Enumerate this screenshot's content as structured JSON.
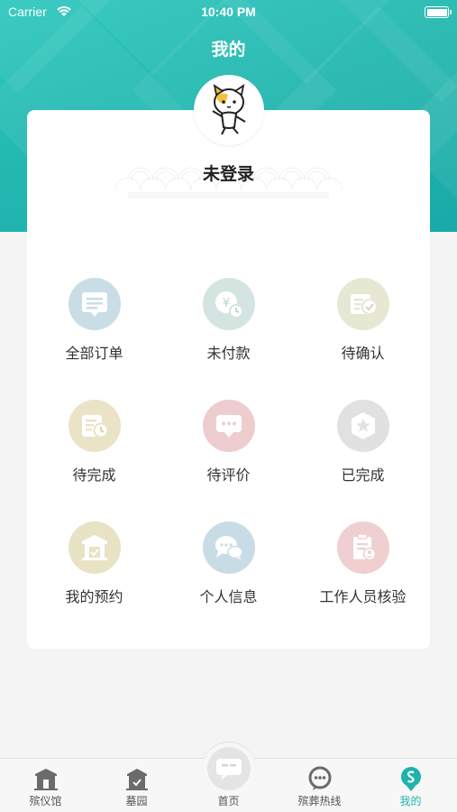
{
  "status_bar": {
    "carrier": "Carrier",
    "time": "10:40 PM"
  },
  "header": {
    "title": "我的"
  },
  "profile": {
    "login_status": "未登录",
    "avatar_icon": "cat-mascot-icon"
  },
  "menu": {
    "items": [
      {
        "label": "全部订单",
        "icon": "order-list-icon",
        "color": "#c9dde6"
      },
      {
        "label": "未付款",
        "icon": "unpaid-yen-clock-icon",
        "color": "#d4e5e1"
      },
      {
        "label": "待确认",
        "icon": "pending-confirm-icon",
        "color": "#e6e8d3"
      },
      {
        "label": "待完成",
        "icon": "pending-complete-icon",
        "color": "#ebe3c7"
      },
      {
        "label": "待评价",
        "icon": "pending-review-chat-icon",
        "color": "#eecdcf"
      },
      {
        "label": "已完成",
        "icon": "completed-star-icon",
        "color": "#e1e1e1"
      },
      {
        "label": "我的预约",
        "icon": "reservation-building-icon",
        "color": "#e7e3c4"
      },
      {
        "label": "个人信息",
        "icon": "personal-info-chat-icon",
        "color": "#c8dce6"
      },
      {
        "label": "工作人员核验",
        "icon": "staff-verify-clipboard-icon",
        "color": "#efcfcf"
      }
    ]
  },
  "tab_bar": {
    "tabs": [
      {
        "label": "殡仪馆",
        "icon": "funeral-home-icon"
      },
      {
        "label": "墓园",
        "icon": "cemetery-icon"
      },
      {
        "label": "首页",
        "icon": "home-chat-icon"
      },
      {
        "label": "殡葬热线",
        "icon": "hotline-icon"
      },
      {
        "label": "我的",
        "icon": "my-profile-icon"
      }
    ],
    "active_color": "#1eb3ad",
    "inactive_color": "#6b6b6b"
  }
}
